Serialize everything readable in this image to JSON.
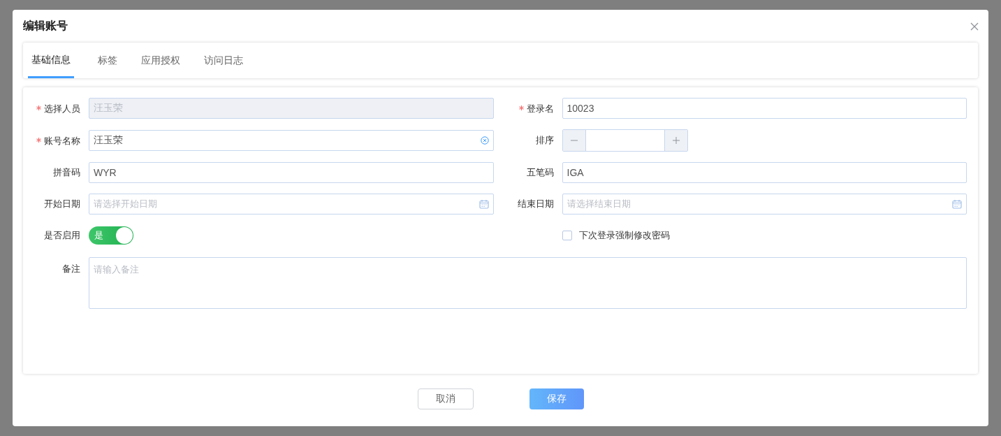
{
  "dialog": {
    "title": "编辑账号"
  },
  "tabs": [
    {
      "label": "基础信息",
      "selected": true
    },
    {
      "label": "标签",
      "selected": false
    },
    {
      "label": "应用授权",
      "selected": false
    },
    {
      "label": "访问日志",
      "selected": false
    }
  ],
  "fields": [
    {
      "kind": "input",
      "label": "选择人员",
      "required": true,
      "value": "汪玉荣",
      "disabled": true,
      "clearable": false
    },
    {
      "kind": "input",
      "label": "登录名",
      "required": true,
      "value": "10023",
      "disabled": false,
      "clearable": false
    },
    {
      "kind": "input",
      "label": "账号名称",
      "required": true,
      "value": "汪玉荣",
      "disabled": false,
      "clearable": true
    },
    {
      "kind": "stepper",
      "label": "排序",
      "required": false
    },
    {
      "kind": "input",
      "label": "拼音码",
      "required": false,
      "value": "WYR",
      "disabled": false,
      "clearable": false
    },
    {
      "kind": "input",
      "label": "五笔码",
      "required": false,
      "value": "IGA",
      "disabled": false,
      "clearable": false
    },
    {
      "kind": "date",
      "label": "开始日期",
      "required": false,
      "placeholder": "请选择开始日期"
    },
    {
      "kind": "date",
      "label": "结束日期",
      "required": false,
      "placeholder": "请选择结束日期"
    },
    {
      "kind": "switch",
      "label": "是否启用",
      "required": false,
      "on": true,
      "text": "是"
    },
    {
      "kind": "checkbox",
      "text": "下次登录强制修改密码",
      "checked": false
    },
    {
      "kind": "textarea",
      "label": "备注",
      "required": false,
      "placeholder": "请输入备注"
    }
  ],
  "buttons": [
    {
      "kind": "secondary",
      "label": "取消"
    },
    {
      "kind": "primary",
      "label": "保存"
    }
  ]
}
